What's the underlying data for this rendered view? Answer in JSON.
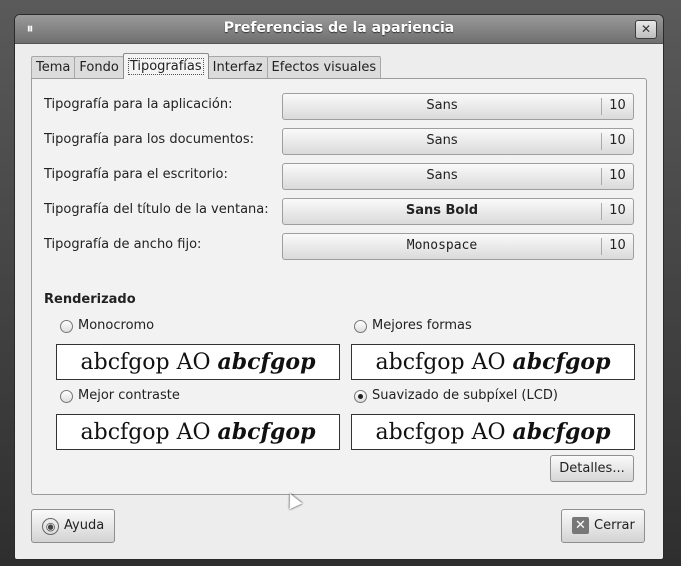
{
  "window": {
    "title": "Preferencias de la apariencia",
    "icon": "window-menu-icon",
    "close_glyph": "✕"
  },
  "tabs": [
    {
      "label": "Tema"
    },
    {
      "label": "Fondo"
    },
    {
      "label": "Tipografías",
      "active": true
    },
    {
      "label": "Interfaz"
    },
    {
      "label": "Efectos visuales"
    }
  ],
  "fonts": [
    {
      "label": "Tipografía para la aplicación:",
      "font": "Sans",
      "size": "10"
    },
    {
      "label": "Tipografía para los documentos:",
      "font": "Sans",
      "size": "10"
    },
    {
      "label": "Tipografía para el escritorio:",
      "font": "Sans",
      "size": "10"
    },
    {
      "label": "Tipografía del título de la ventana:",
      "font": "Sans Bold",
      "size": "10"
    },
    {
      "label": "Tipografía de ancho fijo:",
      "font": "Monospace",
      "size": "10"
    }
  ],
  "rendering": {
    "title": "Renderizado",
    "options": [
      {
        "label": "Monocromo",
        "checked": false
      },
      {
        "label": "Mejores formas",
        "checked": false
      },
      {
        "label": "Mejor contraste",
        "checked": false
      },
      {
        "label": "Suavizado de subpíxel (LCD)",
        "checked": true
      }
    ],
    "sample_plain": "abcfgop AO ",
    "sample_italic": "abcfgop"
  },
  "buttons": {
    "details": "Detalles...",
    "help": "Ayuda",
    "close": "Cerrar"
  }
}
